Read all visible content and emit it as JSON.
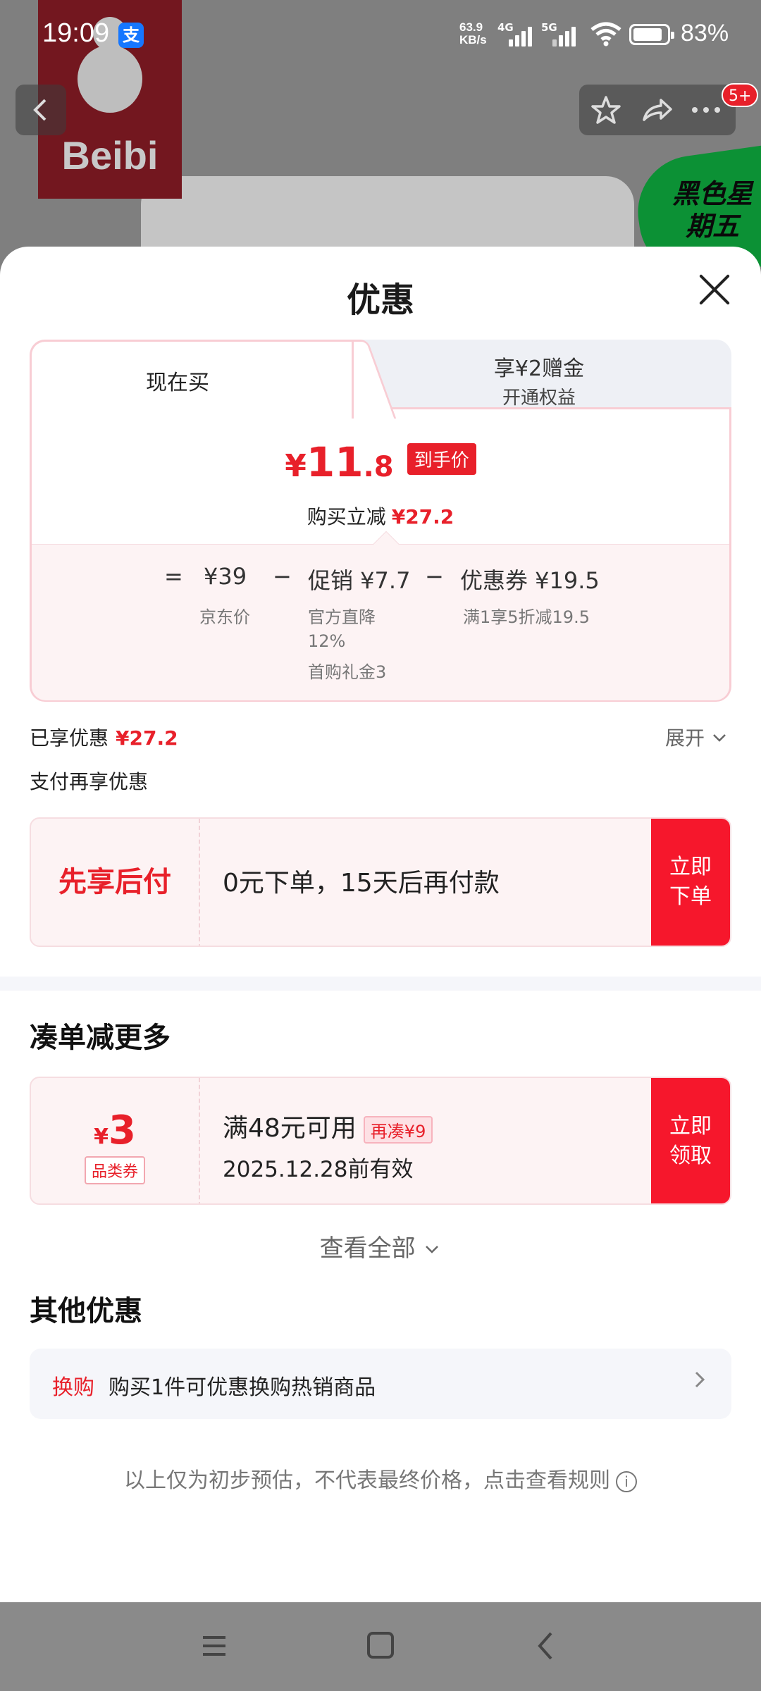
{
  "status_bar": {
    "time": "19:09",
    "alipay": "支",
    "speed_top": "63.9",
    "speed_bottom": "KB/s",
    "net1": "4G",
    "net2": "5G",
    "battery": "83%"
  },
  "background": {
    "brand": "Beibi",
    "promo_sticker": "黑色星期五",
    "notification_count": "5+"
  },
  "sheet": {
    "title": "优惠",
    "tabs": {
      "active_label": "现在买",
      "other_line1": "享¥2赠金",
      "other_line2": "开通权益"
    },
    "price": {
      "symbol": "¥",
      "integer": "11",
      "decimal": ".8",
      "tag": "到手价"
    },
    "saving": {
      "label": "购买立减",
      "amount": "¥27.2"
    },
    "breakdown": {
      "eq": "=",
      "jd_price": "¥39",
      "jd_label": "京东价",
      "minus1": "−",
      "promo": "促销 ¥7.7",
      "promo_sub1": "官方直降",
      "promo_sub2": "12%",
      "promo_sub3": "首购礼金3",
      "minus2": "−",
      "coupon": "优惠券 ¥19.5",
      "coupon_sub": "满1享5折减19.5"
    },
    "enjoyed": {
      "label": "已享优惠",
      "amount": "¥27.2",
      "expand": "展开"
    },
    "pay_again_label": "支付再享优惠",
    "bnpl": {
      "title": "先享后付",
      "desc": "0元下单，15天后再付款",
      "button_line1": "立即",
      "button_line2": "下单"
    },
    "bundle_title": "凑单减更多",
    "coupon": {
      "symbol": "¥",
      "amount": "3",
      "type": "品类券",
      "condition": "满48元可用",
      "gap": "再凑¥9",
      "expiry": "2025.12.28前有效",
      "button_line1": "立即",
      "button_line2": "领取"
    },
    "view_all": "查看全部",
    "other_title": "其他优惠",
    "other_offer": {
      "tag": "换购",
      "text": "购买1件可优惠换购热销商品"
    },
    "disclaimer": "以上仅为初步预估，不代表最终价格，点击查看规则"
  },
  "colors": {
    "accent_red": "#e8202a",
    "button_red": "#f6172c",
    "card_pink": "#fdf3f4"
  }
}
